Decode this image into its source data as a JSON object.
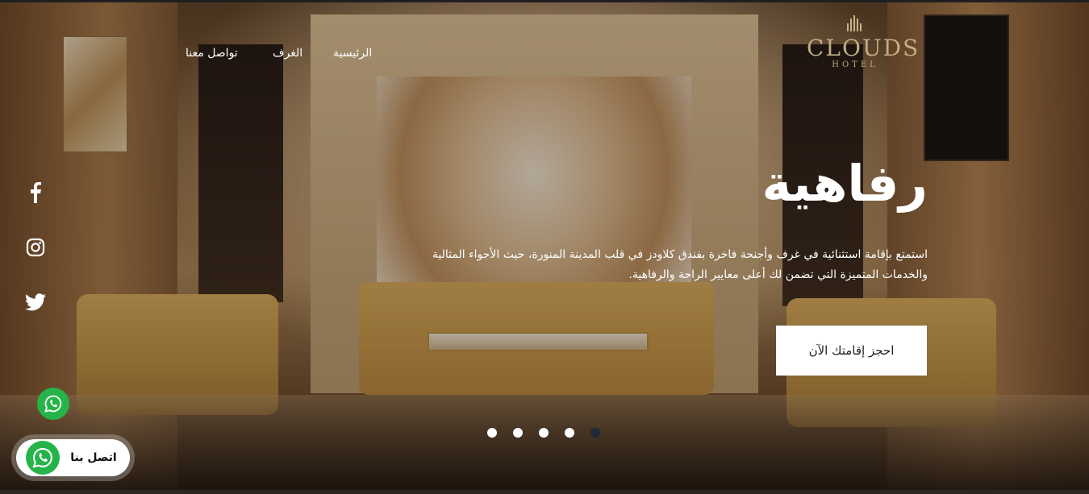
{
  "nav": {
    "items": [
      {
        "label": "الرئيسية"
      },
      {
        "label": "الغرف"
      },
      {
        "label": "تواصل معنا"
      }
    ]
  },
  "logo": {
    "main": "CLOUDS",
    "sub": "HOTEL"
  },
  "hero": {
    "title": "رفاهية",
    "description": "استمتع بإقامة استثنائية في غرف وأجنحة فاخرة بفندق كلاودز في قلب المدينة المنورة، حيث الأجواء المثالية والخدمات المتميزة التي تضمن لك أعلى معايير الراحة والرفاهية.",
    "cta_label": "احجز إقامتك الآن"
  },
  "social": {
    "icons": [
      "facebook-icon",
      "instagram-icon",
      "twitter-icon"
    ]
  },
  "slider": {
    "dot_count": 5,
    "active_index": 4
  },
  "contact": {
    "label": "اتصل بنا"
  },
  "colors": {
    "whatsapp": "#26b44a",
    "logo_gold": "#c2ad83",
    "active_dot": "#1e2a3a"
  }
}
